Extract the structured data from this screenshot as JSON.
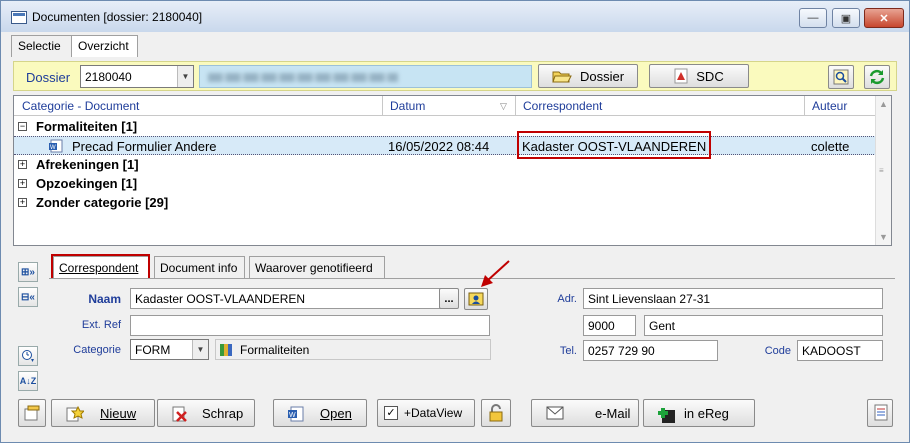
{
  "window": {
    "title": "Documenten  [dossier: 2180040]"
  },
  "top_tabs": [
    {
      "label": "Selectie"
    },
    {
      "label": "Overzicht"
    }
  ],
  "dossier": {
    "label": "Dossier",
    "number": "2180040",
    "btn_dossier": "Dossier",
    "btn_sdc": "SDC"
  },
  "grid": {
    "columns": [
      "Categorie - Document",
      "Datum",
      "Correspondent",
      "Auteur"
    ],
    "groups": [
      {
        "label": "Formaliteiten [1]",
        "expander": "⊟"
      },
      {
        "label": "Afrekeningen [1]",
        "expander": "⊞"
      },
      {
        "label": "Opzoekingen [1]",
        "expander": "⊞"
      },
      {
        "label": "Zonder categorie [29]",
        "expander": "⊞"
      }
    ],
    "selected_row": {
      "document": "Precad Formulier Andere",
      "datum": "16/05/2022 08:44",
      "correspondent": "Kadaster OOST-VLAANDEREN",
      "auteur": "colette"
    }
  },
  "detail_tabs": [
    {
      "label": "Correspondent"
    },
    {
      "label": "Document info"
    },
    {
      "label": "Waarover genotifieerd"
    }
  ],
  "detail": {
    "naam_label": "Naam",
    "naam_value": "Kadaster OOST-VLAANDEREN",
    "ellipsis": "...",
    "extref_label": "Ext. Ref",
    "extref_value": "",
    "categorie_label": "Categorie",
    "categorie_value": "FORM",
    "categorie_name": "Formaliteiten",
    "adr_label": "Adr.",
    "adr_value": "Sint Lievenslaan 27-31",
    "postcode": "9000",
    "city": "Gent",
    "tel_label": "Tel.",
    "tel_value": "0257 729 90",
    "code_label": "Code",
    "code_value": "KADOOST"
  },
  "bottom": {
    "nieuw": "Nieuw",
    "schrap": "Schrap",
    "open": "Open",
    "dataview": "+DataView",
    "email": "e-Mail",
    "ereg": "in eReg"
  },
  "colors": {
    "highlight": "#c00000",
    "dossier_bar": "#fafabe",
    "label_blue": "#1f3d9a"
  }
}
